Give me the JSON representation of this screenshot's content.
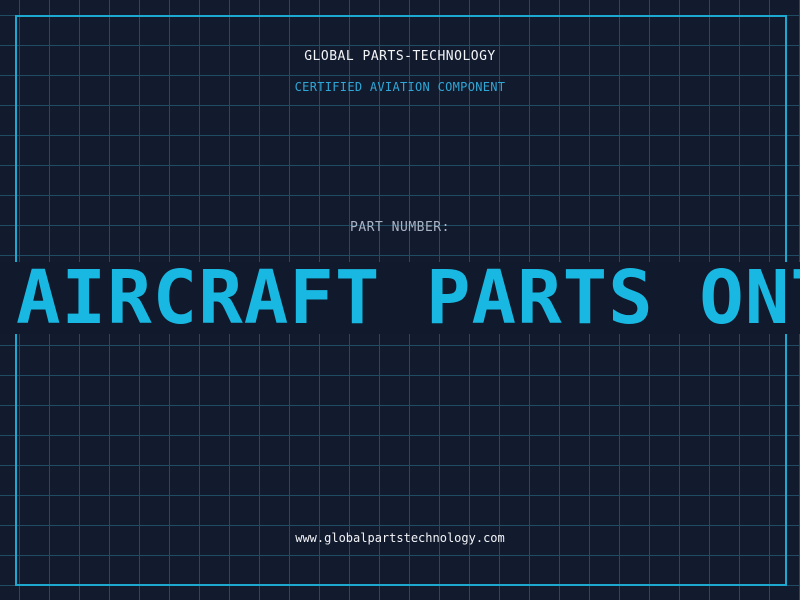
{
  "header": {
    "company": "GLOBAL PARTS-TECHNOLOGY",
    "subtitle": "CERTIFIED AVIATION COMPONENT"
  },
  "part": {
    "label": "PART NUMBER:",
    "value": "AIRCRAFT PARTS ONT"
  },
  "footer": {
    "website": "www.globalpartstechnology.com"
  },
  "colors": {
    "background": "#121a2e",
    "grid": "#1f4b63",
    "accent": "#1da8d0",
    "banner_text": "#19b8e2"
  }
}
